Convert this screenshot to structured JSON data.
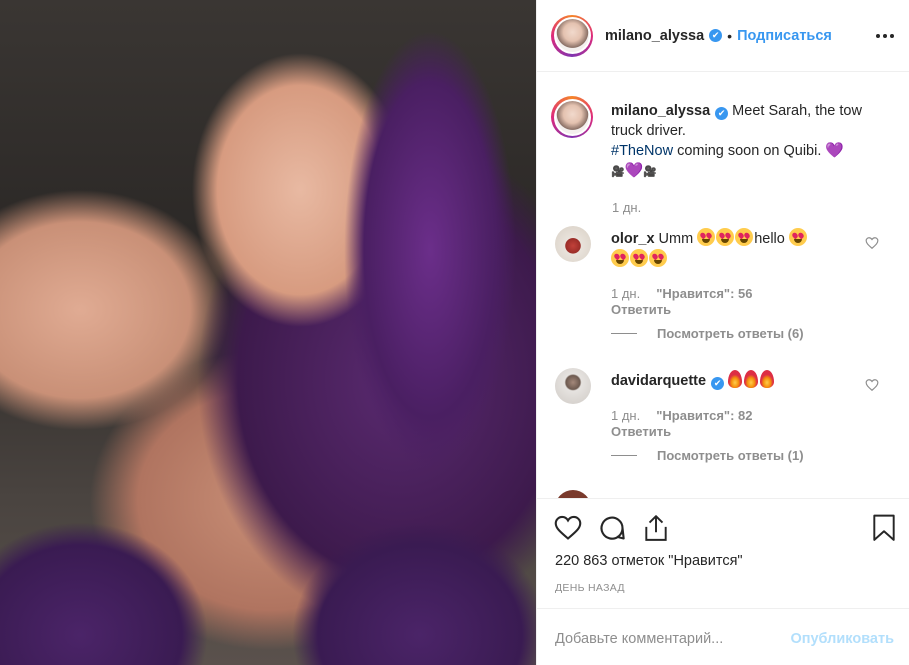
{
  "post": {
    "username": "milano_alyssa",
    "verified_mark": "✔",
    "separator": "•",
    "follow_label": "Подписаться",
    "more_label": "•••"
  },
  "caption": {
    "username": "milano_alyssa",
    "text_line1": " Meet Sarah, the tow truck driver.",
    "hashtag": "#TheNow",
    "text_line2": " coming soon on Quibi. ",
    "heart": "💜",
    "line3_left": "🎥",
    "line3_heart": "💜",
    "line3_right": "🎥",
    "time": "1 дн."
  },
  "comments": [
    {
      "username": "olor_x",
      "text": " Umm ",
      "text_mid": "hello ",
      "time": "1 дн.",
      "likes": "\"Нравится\": 56",
      "reply": "Ответить",
      "view_replies": "Посмотреть ответы (6)"
    },
    {
      "username": "davidarquette",
      "verified_mark": "✔",
      "time": "1 дн.",
      "likes": "\"Нравится\": 82",
      "reply": "Ответить",
      "view_replies": "Посмотреть ответы (1)"
    }
  ],
  "actions": {
    "likes_count": "220 863 отметок \"Нравится\"",
    "post_time": "ДЕНЬ НАЗАД"
  },
  "add_comment": {
    "placeholder": "Добавьте комментарий...",
    "publish_label": "Опубликовать"
  },
  "colors": {
    "link_blue": "#3897f0",
    "hashtag": "#003569",
    "muted": "#8e8e8e",
    "publish_disabled": "#b2dffc"
  },
  "icons": [
    "heart-icon",
    "comment-icon",
    "share-icon",
    "bookmark-icon",
    "more-icon",
    "verified-icon"
  ]
}
